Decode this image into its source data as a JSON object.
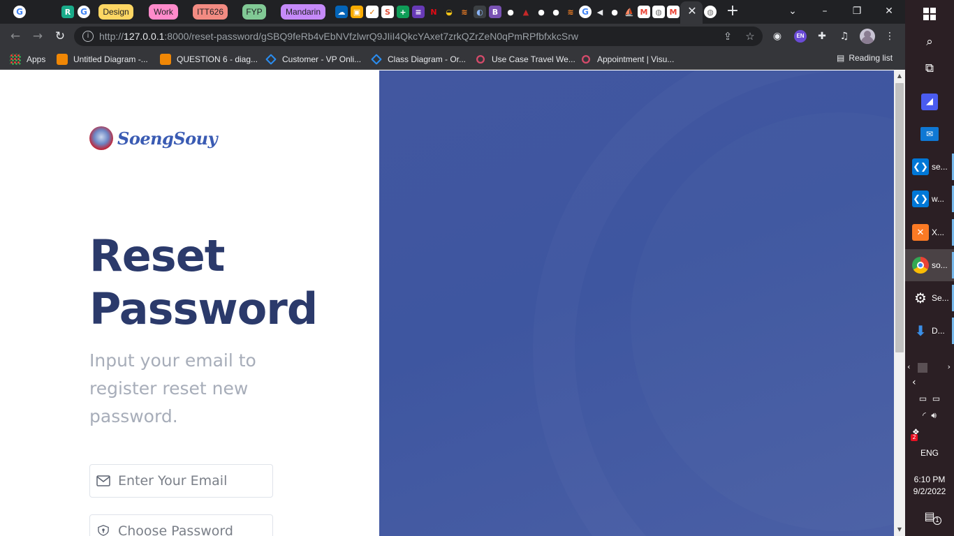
{
  "browser": {
    "tab_groups": [
      {
        "label": "Design",
        "color": "#fdd663"
      },
      {
        "label": "Work",
        "color": "#ff8bcb"
      },
      {
        "label": "ITT626",
        "color": "#f28b82"
      },
      {
        "label": "FYP",
        "color": "#81c995"
      },
      {
        "label": "Mandarin",
        "color": "#c58af9"
      }
    ],
    "url_host": "127.0.0.1",
    "url_rest": ":8000/reset-password/gSBQ9feRb4vEbNVfzlwrQ9JIiI4QkcYAxet7zrkQZrZeN0qPmRPfbfxkcSrw",
    "url_prefix": "http://",
    "profile_badge": "EN",
    "bookmarks": [
      {
        "label": "Apps",
        "icon": "apps-grid-icon"
      },
      {
        "label": "Untitled Diagram -...",
        "icon": "drawio-icon"
      },
      {
        "label": "QUESTION 6 - diag...",
        "icon": "drawio-icon"
      },
      {
        "label": "Customer - VP Onli...",
        "icon": "visual-paradigm-icon"
      },
      {
        "label": "Class Diagram - Or...",
        "icon": "visual-paradigm-icon"
      },
      {
        "label": "Use Case Travel We...",
        "icon": "visual-paradigm-icon"
      },
      {
        "label": "Appointment | Visu...",
        "icon": "visual-paradigm-icon"
      }
    ],
    "reading_list": "Reading list"
  },
  "page": {
    "brand": "SoengSouy",
    "title": "Reset Password",
    "subtitle": "Input your email to register reset new password.",
    "email_placeholder": "Enter Your Email",
    "password_placeholder": "Choose Password",
    "accent_color": "#2b3a6b",
    "panel_color": "#4257a0"
  },
  "taskbar": {
    "apps": [
      {
        "label": "se...",
        "icon": "vscode-icon"
      },
      {
        "label": "w...",
        "icon": "vscode-icon"
      },
      {
        "label": "X...",
        "icon": "xampp-icon"
      },
      {
        "label": "so...",
        "icon": "chrome-icon"
      },
      {
        "label": "Se...",
        "icon": "settings-icon"
      },
      {
        "label": "D...",
        "icon": "downloads-icon"
      }
    ],
    "language": "ENG",
    "time": "6:10 PM",
    "date": "9/2/2022",
    "notifications_count": "1",
    "dropbox_badge": "2"
  }
}
